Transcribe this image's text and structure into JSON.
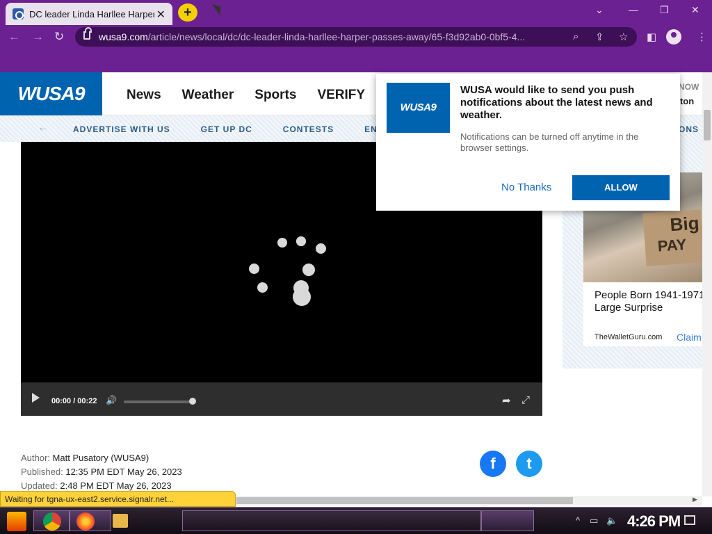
{
  "browser": {
    "tab_title": "DC leader Linda Harllee Harper",
    "new_tab": "+",
    "url_host": "wusa9.com",
    "url_path": "/article/news/local/dc/dc-leader-linda-harllee-harper-passes-away/65-f3d92ab0-0bf5-4...",
    "icons": [
      "back-icon",
      "forward-icon",
      "reload-icon",
      "lock-icon",
      "search-icon",
      "share-icon",
      "star-icon",
      "sidepanel-icon",
      "profile-icon"
    ]
  },
  "site": {
    "logo": "WUSA9",
    "nav": [
      "News",
      "Weather",
      "Sports",
      "VERIFY"
    ],
    "now": "NOW",
    "location": "gton",
    "subnav": [
      "ADVERTISE WITH US",
      "GET UP DC",
      "CONTESTS",
      "ENV"
    ],
    "subnav_right": "ONS"
  },
  "video": {
    "time": "00:00 / 00:22",
    "progress": 0
  },
  "article": {
    "author_label": "Author:",
    "author": "Matt Pusatory (WUSA9)",
    "published_label": "Published:",
    "published": "12:35 PM EDT May 26, 2023",
    "updated_label": "Updated:",
    "updated": "2:48 PM EDT May 26, 2023"
  },
  "social": {
    "facebook": "f",
    "twitter": "t"
  },
  "ad": {
    "sign_line1": "Big",
    "sign_line2": "PAY",
    "title": "People Born 1941-1971\nLarge Surprise",
    "source": "TheWalletGuru.com",
    "claim": "Claim"
  },
  "popup": {
    "logo": "WUSA9",
    "title": "WUSA would like to send you push notifications about the latest news and weather.",
    "description": "Notifications can be turned off anytime in the browser settings.",
    "no_thanks": "No Thanks",
    "allow": "ALLOW"
  },
  "status": "Waiting for tgna-ux-east2.service.signalr.net...",
  "taskbar": {
    "clock": "4:26 PM"
  },
  "colors": {
    "brand": "#0063b0",
    "chrome": "#6b2191",
    "status": "#ffd23a"
  }
}
